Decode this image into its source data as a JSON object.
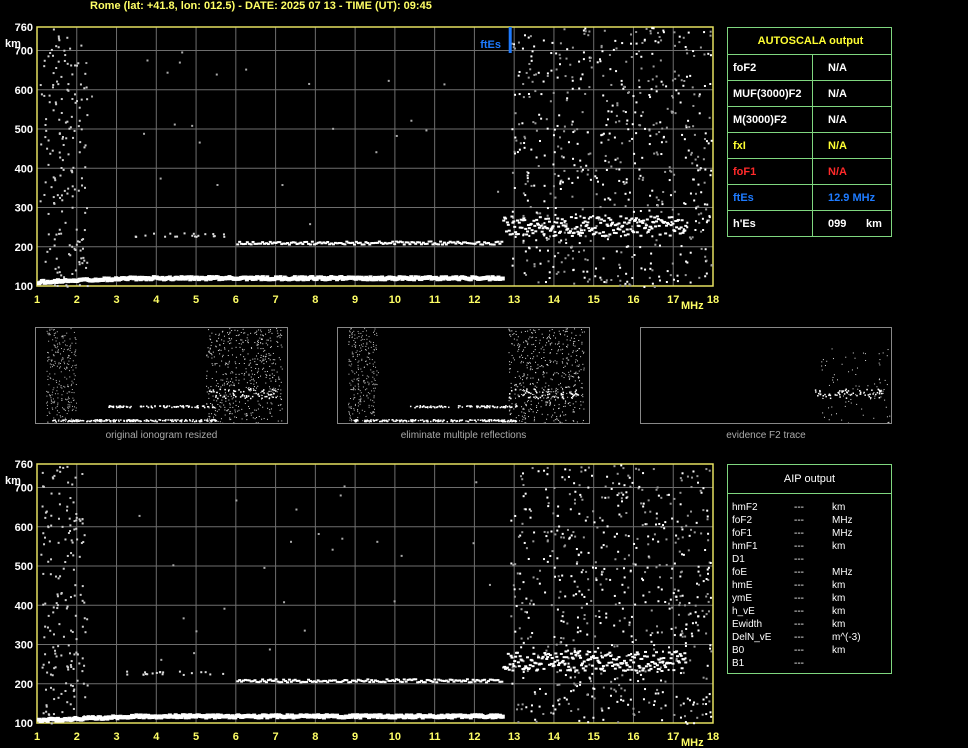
{
  "header": {
    "title": "Rome (lat: +41.8, lon: 012.5) - DATE: 2025 07 13 - TIME (UT): 09:45"
  },
  "chart_data": [
    {
      "type": "scatter",
      "name": "ionogram-top",
      "xlabel": "MHz",
      "ylabel": "km",
      "xlim": [
        1,
        18
      ],
      "ylim": [
        100,
        760
      ],
      "x_ticks": [
        "1",
        "2",
        "3",
        "4",
        "5",
        "6",
        "7",
        "8",
        "9",
        "10",
        "11",
        "12",
        "13",
        "14",
        "15",
        "16",
        "17",
        "18"
      ],
      "y_ticks": [
        "100",
        "200",
        "300",
        "400",
        "500",
        "600",
        "700",
        "760"
      ],
      "grid": true,
      "annotations": [
        {
          "label": "ftEs",
          "x": 12.9,
          "color": "#1e7bff"
        }
      ],
      "traces": [
        {
          "x_start": 1.0,
          "x_end": 12.7,
          "y": 115,
          "label": "E-region trace"
        },
        {
          "x_start": 5.0,
          "x_end": 12.7,
          "y": 212,
          "label": "Es reflection"
        },
        {
          "x_start": 12.7,
          "x_end": 17.3,
          "y": 255,
          "label": "scattered trace"
        }
      ]
    },
    {
      "type": "scatter",
      "name": "ionogram-bottom",
      "xlabel": "MHz",
      "ylabel": "km",
      "xlim": [
        1,
        18
      ],
      "ylim": [
        100,
        760
      ],
      "x_ticks": [
        "1",
        "2",
        "3",
        "4",
        "5",
        "6",
        "7",
        "8",
        "9",
        "10",
        "11",
        "12",
        "13",
        "14",
        "15",
        "16",
        "17",
        "18"
      ],
      "y_ticks": [
        "100",
        "200",
        "300",
        "400",
        "500",
        "600",
        "700",
        "760"
      ],
      "grid": true,
      "traces": [
        {
          "x_start": 1.0,
          "x_end": 12.7,
          "y": 112,
          "label": "E-region trace"
        },
        {
          "x_start": 5.0,
          "x_end": 12.7,
          "y": 210,
          "label": "Es reflection"
        },
        {
          "x_start": 12.7,
          "x_end": 17.3,
          "y": 260,
          "label": "scattered trace"
        }
      ]
    }
  ],
  "autoscala": {
    "title": "AUTOSCALA output",
    "rows": [
      {
        "label": "foF2",
        "value": "N/A",
        "unit": "",
        "color": "#ffffff"
      },
      {
        "label": "MUF(3000)F2",
        "value": "N/A",
        "unit": "",
        "color": "#ffffff"
      },
      {
        "label": "M(3000)F2",
        "value": "N/A",
        "unit": "",
        "color": "#ffffff"
      },
      {
        "label": "fxI",
        "value": "N/A",
        "unit": "",
        "color": "#ffff33"
      },
      {
        "label": "foF1",
        "value": "N/A",
        "unit": "",
        "color": "#ff2a2a"
      },
      {
        "label": "ftEs",
        "value": "12.9 MHz",
        "unit": "",
        "color": "#1e7bff"
      },
      {
        "label": "h'Es",
        "value": "099",
        "unit": "km",
        "color": "#ffffff"
      }
    ]
  },
  "thumbnails": [
    {
      "caption": "original ionogram resized"
    },
    {
      "caption": "eliminate multiple reflections"
    },
    {
      "caption": "evidence F2 trace"
    }
  ],
  "aip": {
    "title": "AIP output",
    "rows": [
      {
        "label": "hmF2",
        "value": "---",
        "unit": "km"
      },
      {
        "label": "foF2",
        "value": "---",
        "unit": "MHz"
      },
      {
        "label": "foF1",
        "value": "---",
        "unit": "MHz"
      },
      {
        "label": "hmF1",
        "value": "---",
        "unit": "km"
      },
      {
        "label": "D1",
        "value": "---",
        "unit": ""
      },
      {
        "label": "foE",
        "value": "---",
        "unit": "MHz"
      },
      {
        "label": "hmE",
        "value": "---",
        "unit": "km"
      },
      {
        "label": "ymE",
        "value": "---",
        "unit": "km"
      },
      {
        "label": "h_vE",
        "value": "---",
        "unit": "km"
      },
      {
        "label": "Ewidth",
        "value": "---",
        "unit": "km"
      },
      {
        "label": "DelN_vE",
        "value": "---",
        "unit": "m^(-3)"
      },
      {
        "label": "B0",
        "value": "---",
        "unit": "km"
      },
      {
        "label": "B1",
        "value": "---",
        "unit": ""
      }
    ]
  }
}
